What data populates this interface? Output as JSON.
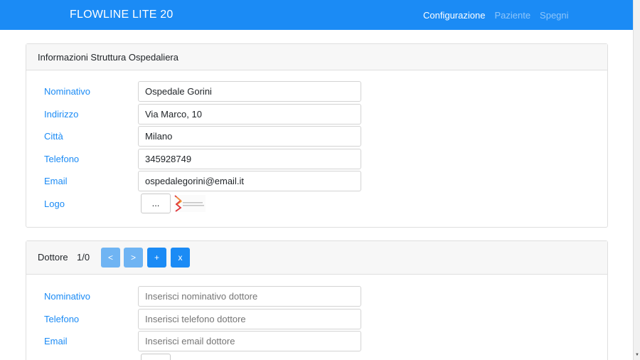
{
  "navbar": {
    "brand": "FLOWLINE LITE 20",
    "links": [
      "Configurazione",
      "Paziente",
      "Spegni"
    ],
    "bg_color": "#1b8bf5"
  },
  "struttura": {
    "title": "Informazioni Struttura Ospedaliera",
    "fields": [
      {
        "label": "Nominativo",
        "value": "Ospedale Gorini",
        "placeholder": ""
      },
      {
        "label": "Indirizzo",
        "value": "Via Marco, 10",
        "placeholder": ""
      },
      {
        "label": "Città",
        "value": "Milano",
        "placeholder": ""
      },
      {
        "label": "Telefono",
        "value": "345928749",
        "placeholder": ""
      },
      {
        "label": "Email",
        "value": "ospedalegorini@email.it",
        "placeholder": ""
      }
    ],
    "logo_label": "Logo",
    "file_button": "..."
  },
  "dottore": {
    "title": "Dottore",
    "counter": "1/0",
    "buttons": {
      "prev": "<",
      "next": ">",
      "add": "+",
      "remove": "x"
    },
    "fields": [
      {
        "label": "Nominativo",
        "value": "",
        "placeholder": "Inserisci nominativo dottore"
      },
      {
        "label": "Telefono",
        "value": "",
        "placeholder": "Inserisci telefono dottore"
      },
      {
        "label": "Email",
        "value": "",
        "placeholder": "Inserisci email dottore"
      }
    ]
  }
}
